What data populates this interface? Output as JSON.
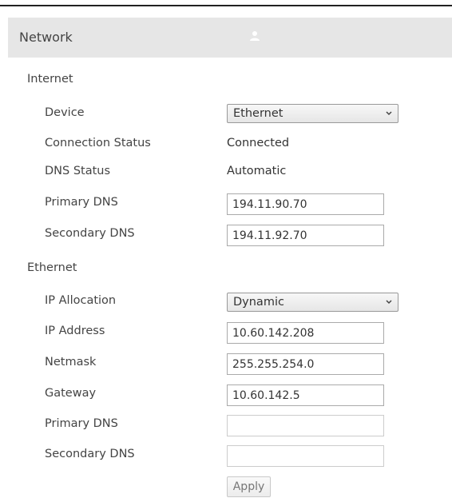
{
  "header": {
    "title": "Network",
    "icon": "person-icon"
  },
  "internet": {
    "section_label": "Internet",
    "device": {
      "label": "Device",
      "value": "Ethernet"
    },
    "connection_status": {
      "label": "Connection Status",
      "value": "Connected"
    },
    "dns_status": {
      "label": "DNS Status",
      "value": "Automatic"
    },
    "primary_dns": {
      "label": "Primary DNS",
      "value": "194.11.90.70"
    },
    "secondary_dns": {
      "label": "Secondary DNS",
      "value": "194.11.92.70"
    }
  },
  "ethernet": {
    "section_label": "Ethernet",
    "ip_allocation": {
      "label": "IP Allocation",
      "value": "Dynamic"
    },
    "ip_address": {
      "label": "IP Address",
      "value": "10.60.142.208"
    },
    "netmask": {
      "label": "Netmask",
      "value": "255.255.254.0"
    },
    "gateway": {
      "label": "Gateway",
      "value": "10.60.142.5"
    },
    "primary_dns": {
      "label": "Primary DNS",
      "value": ""
    },
    "secondary_dns": {
      "label": "Secondary DNS",
      "value": ""
    }
  },
  "apply_label": "Apply"
}
